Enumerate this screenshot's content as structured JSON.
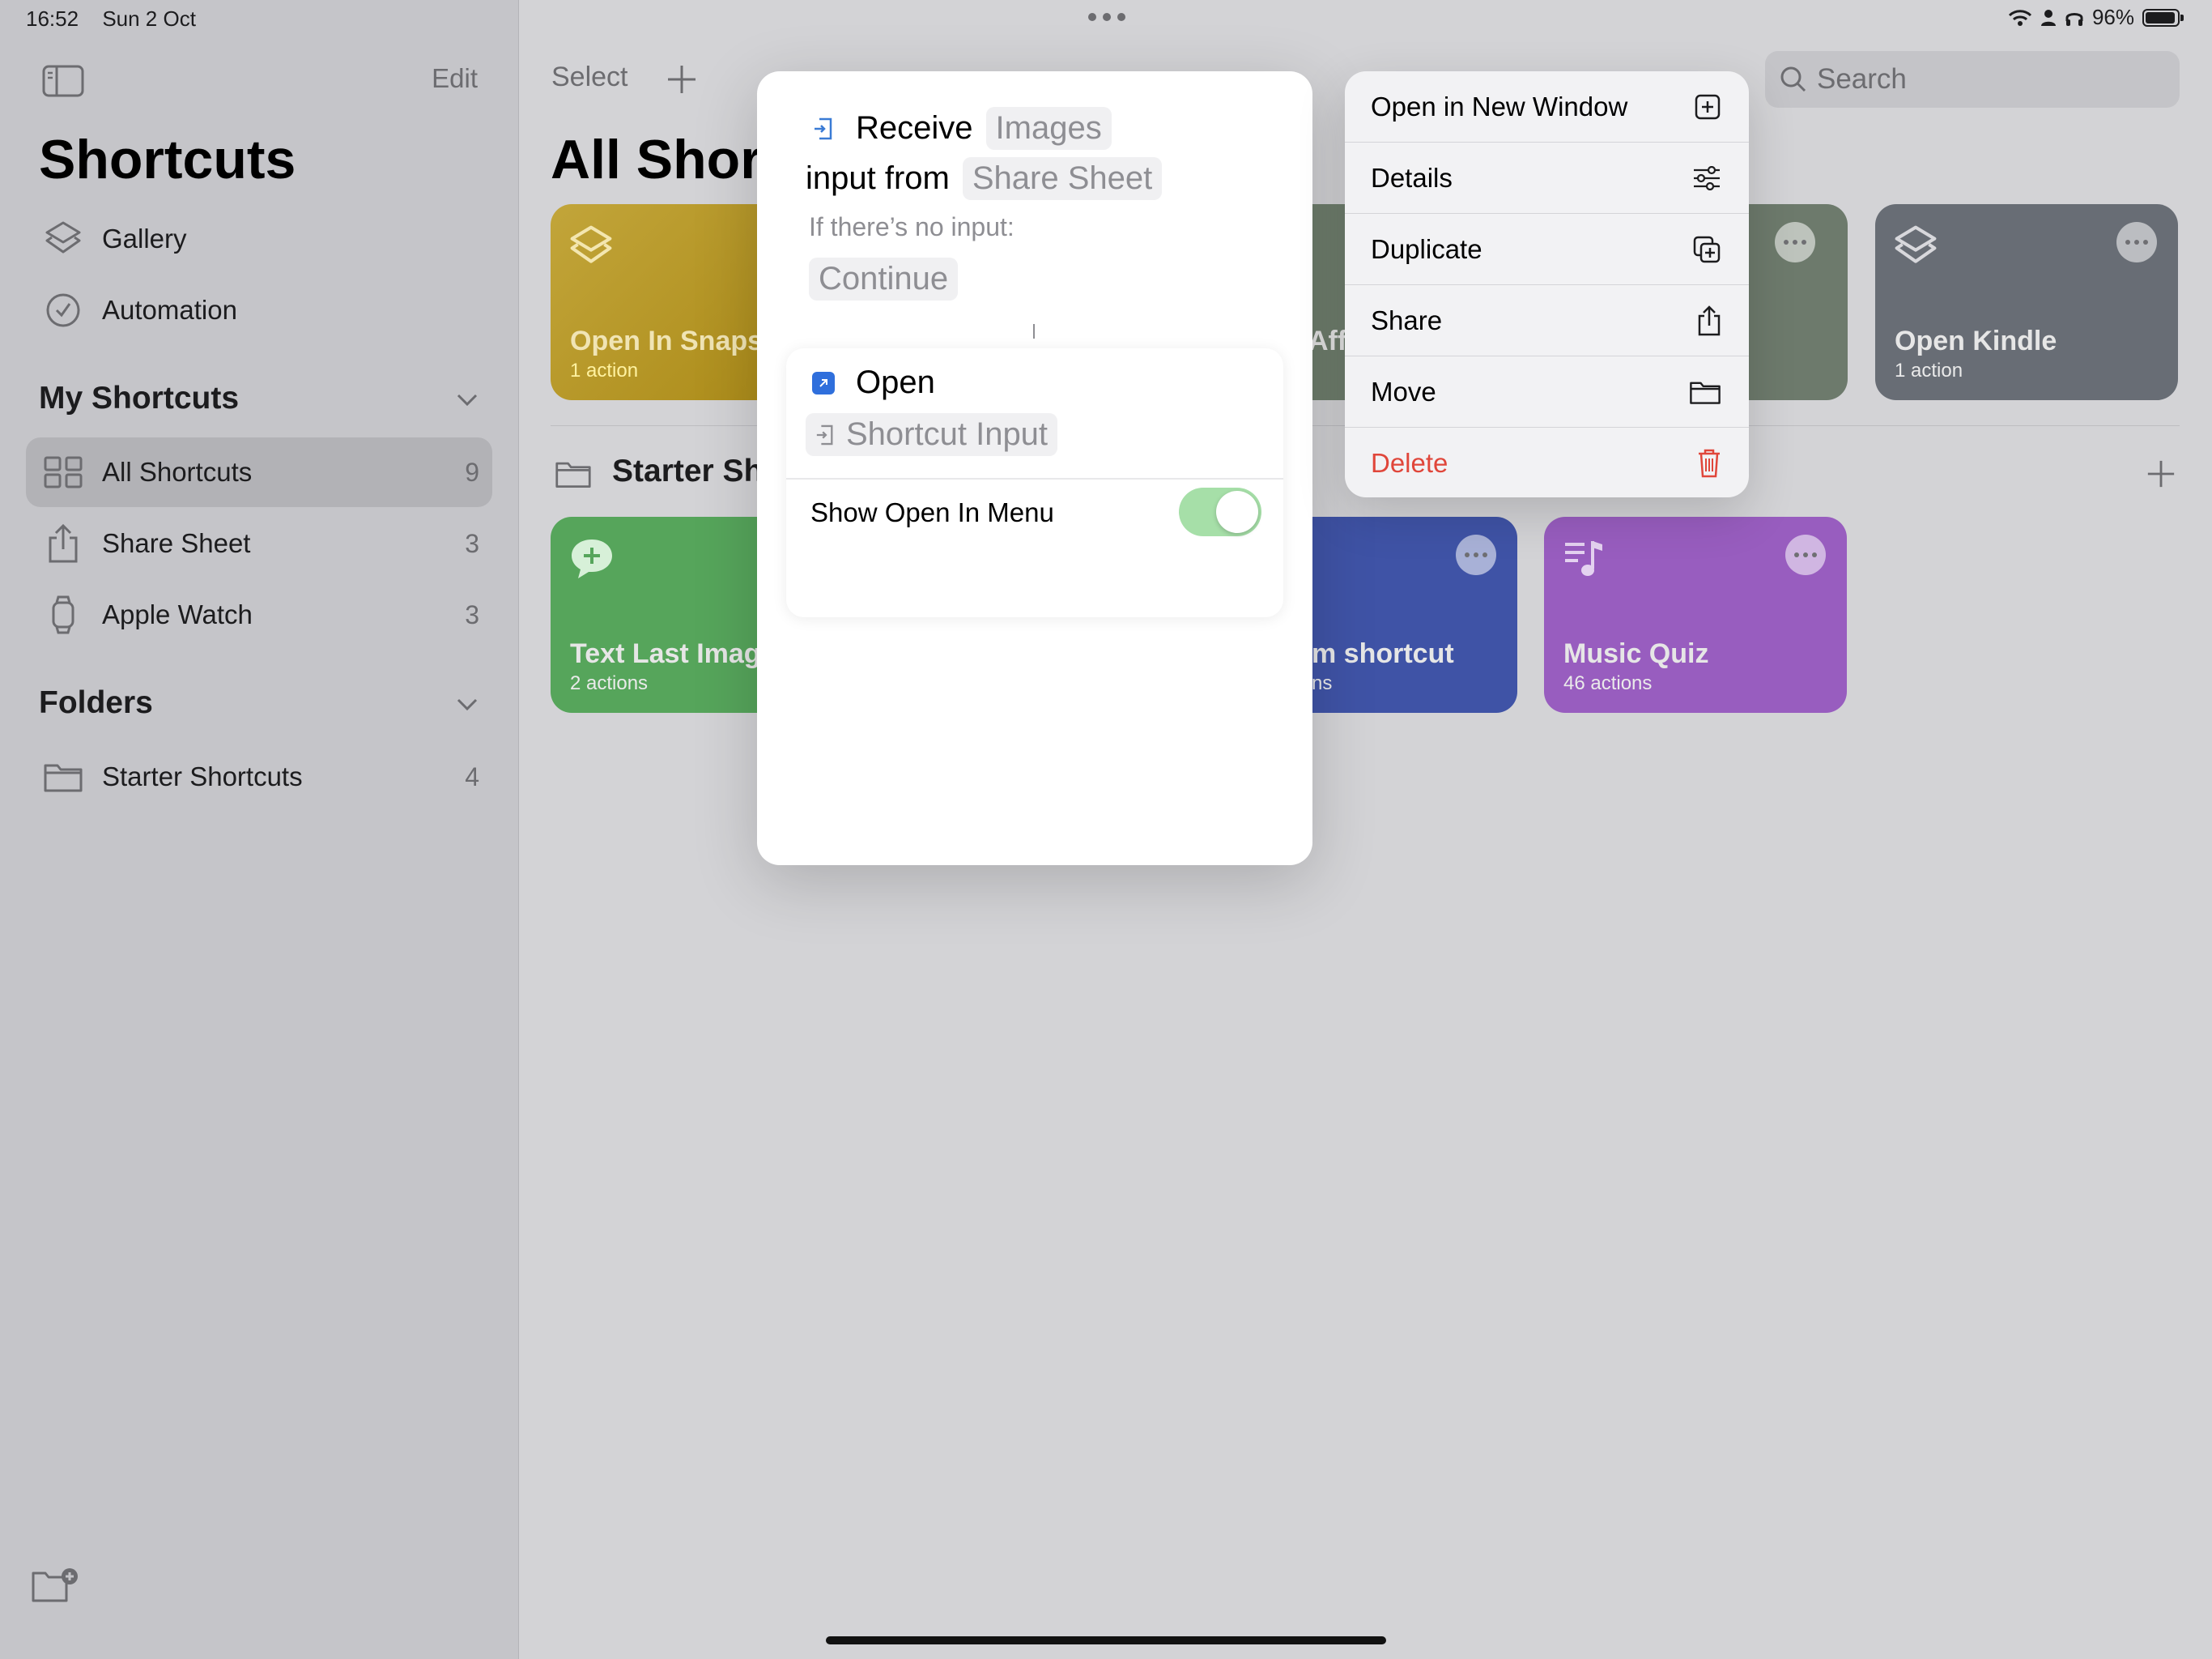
{
  "status": {
    "time": "16:52",
    "date": "Sun 2 Oct",
    "battery": "96%"
  },
  "sidebar": {
    "edit_label": "Edit",
    "title": "Shortcuts",
    "top_items": [
      {
        "label": "Gallery"
      },
      {
        "label": "Automation"
      }
    ],
    "my_shortcuts_header": "My Shortcuts",
    "my_shortcuts": [
      {
        "label": "All Shortcuts",
        "count": "9"
      },
      {
        "label": "Share Sheet",
        "count": "3"
      },
      {
        "label": "Apple Watch",
        "count": "3"
      }
    ],
    "folders_header": "Folders",
    "folders": [
      {
        "label": "Starter Shortcuts",
        "count": "4"
      }
    ]
  },
  "main": {
    "select_label": "Select",
    "search_placeholder": "Search",
    "title": "All Shortcuts",
    "cards_row1": [
      {
        "title": "Open In Snapseed",
        "sub": "1 action",
        "color": "#b89a2c"
      },
      {
        "title": "Aff",
        "sub": "",
        "color": "#6f7f6e"
      },
      {
        "title": "",
        "sub": "",
        "color": "#6d786d"
      },
      {
        "title": "Open Kindle",
        "sub": "1 action",
        "color": "#686c74"
      }
    ],
    "folder_section_title": "Starter Shortcuts",
    "cards_row2": [
      {
        "title": "Text Last Image",
        "sub": "2 actions",
        "color": "#54a35a"
      },
      {
        "title": "m shortcut",
        "sub": "ns",
        "color": "#3f55a8"
      },
      {
        "title": "Music Quiz",
        "sub": "46 actions",
        "color": "#9a5cc0"
      }
    ]
  },
  "preview": {
    "receive_label": "Receive",
    "receive_token": "Images",
    "input_from_label": "input from",
    "input_from_token": "Share Sheet",
    "no_input_label": "If there’s no input:",
    "continue_token": "Continue",
    "open_label": "Open",
    "shortcut_input_token": "Shortcut Input",
    "toggle_label": "Show Open In Menu",
    "toggle_on": true
  },
  "context_menu": {
    "items": [
      {
        "label": "Open in New Window",
        "icon": "new-window-icon"
      },
      {
        "label": "Details",
        "icon": "sliders-icon"
      },
      {
        "label": "Duplicate",
        "icon": "duplicate-icon"
      },
      {
        "label": "Share",
        "icon": "share-icon"
      },
      {
        "label": "Move",
        "icon": "folder-icon"
      },
      {
        "label": "Delete",
        "icon": "trash-icon",
        "color": "#e0463a"
      }
    ]
  }
}
